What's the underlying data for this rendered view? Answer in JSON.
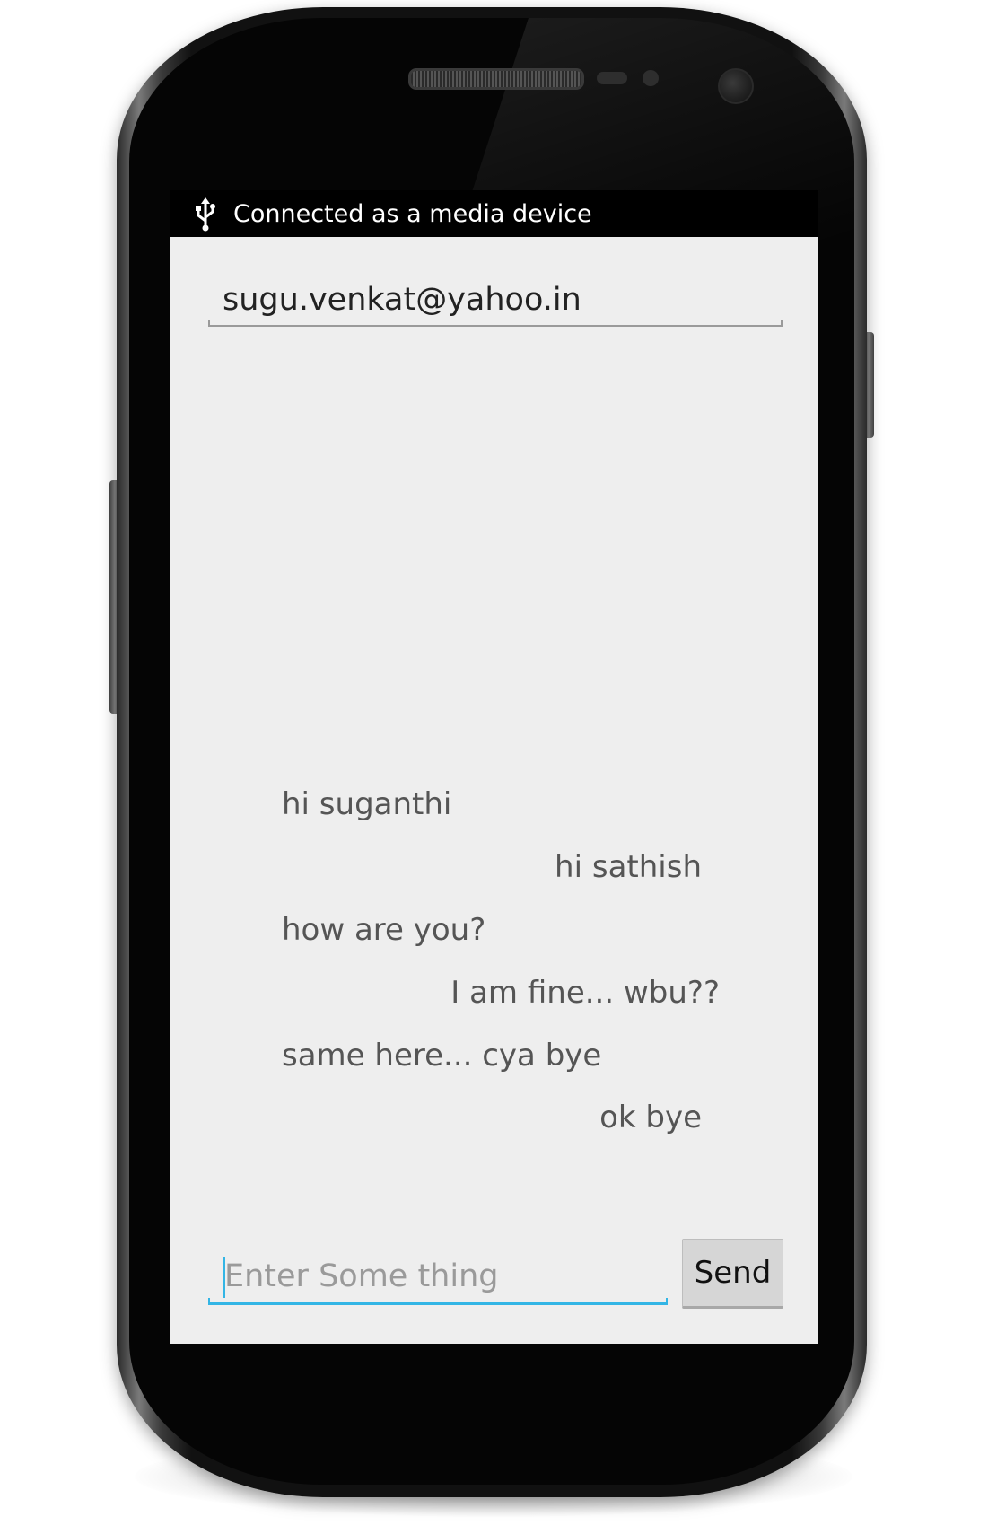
{
  "status_bar": {
    "icon": "usb-icon",
    "text": "Connected as a media device"
  },
  "email_field": {
    "value": "sugu.venkat@yahoo.in"
  },
  "messages": [
    {
      "text": "hi suganthi",
      "side": "left"
    },
    {
      "text": "hi sathish",
      "side": "right"
    },
    {
      "text": "how are you?",
      "side": "left"
    },
    {
      "text": "I am fine... wbu??",
      "side": "right"
    },
    {
      "text": "same here... cya bye",
      "side": "left"
    },
    {
      "text": "ok bye",
      "side": "right"
    }
  ],
  "compose": {
    "placeholder": "Enter Some thing",
    "value": ""
  },
  "send_button": {
    "label": "Send"
  },
  "colors": {
    "screen_background": "#eeeeee",
    "status_bar": "#000000",
    "accent": "#33b5e5",
    "message_text": "#555555"
  }
}
